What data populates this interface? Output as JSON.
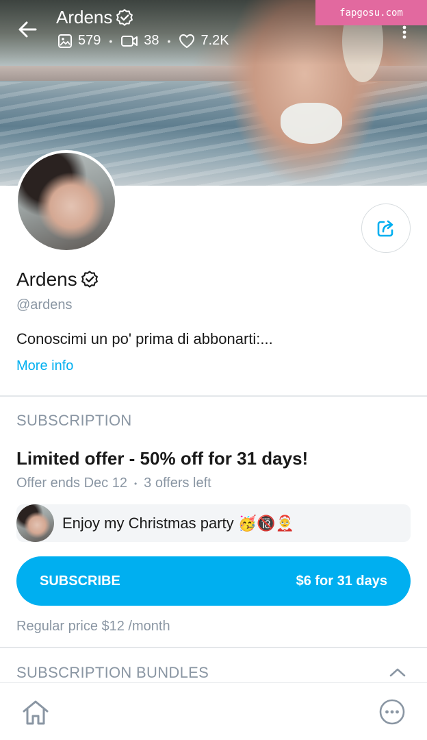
{
  "header": {
    "name": "Ardens",
    "stats": {
      "photos": "579",
      "videos": "38",
      "likes": "7.2K"
    },
    "watermark": "fapgosu.com"
  },
  "profile": {
    "name": "Ardens",
    "handle": "@ardens",
    "bio": "Conoscimi un po' prima di abbonarti:...",
    "more_info": "More info"
  },
  "subscription": {
    "section_title": "SUBSCRIPTION",
    "offer_title": "Limited offer - 50% off for 31 days!",
    "offer_ends": "Offer ends Dec 12",
    "offers_left": "3 offers left",
    "message": "Enjoy my Christmas party 🥳🔞🤶",
    "button_label": "SUBSCRIBE",
    "button_price": "$6 for 31 days",
    "regular_price": "Regular price $12 /month"
  },
  "bundles": {
    "section_title": "SUBSCRIPTION BUNDLES"
  },
  "colors": {
    "accent": "#00aff0",
    "muted": "#8a96a3",
    "watermark": "#e2699f"
  },
  "icons": [
    "back-arrow-icon",
    "image-icon",
    "video-icon",
    "heart-icon",
    "verified-icon",
    "more-vertical-icon",
    "share-icon",
    "chevron-up-icon",
    "home-icon",
    "more-horizontal-icon"
  ]
}
